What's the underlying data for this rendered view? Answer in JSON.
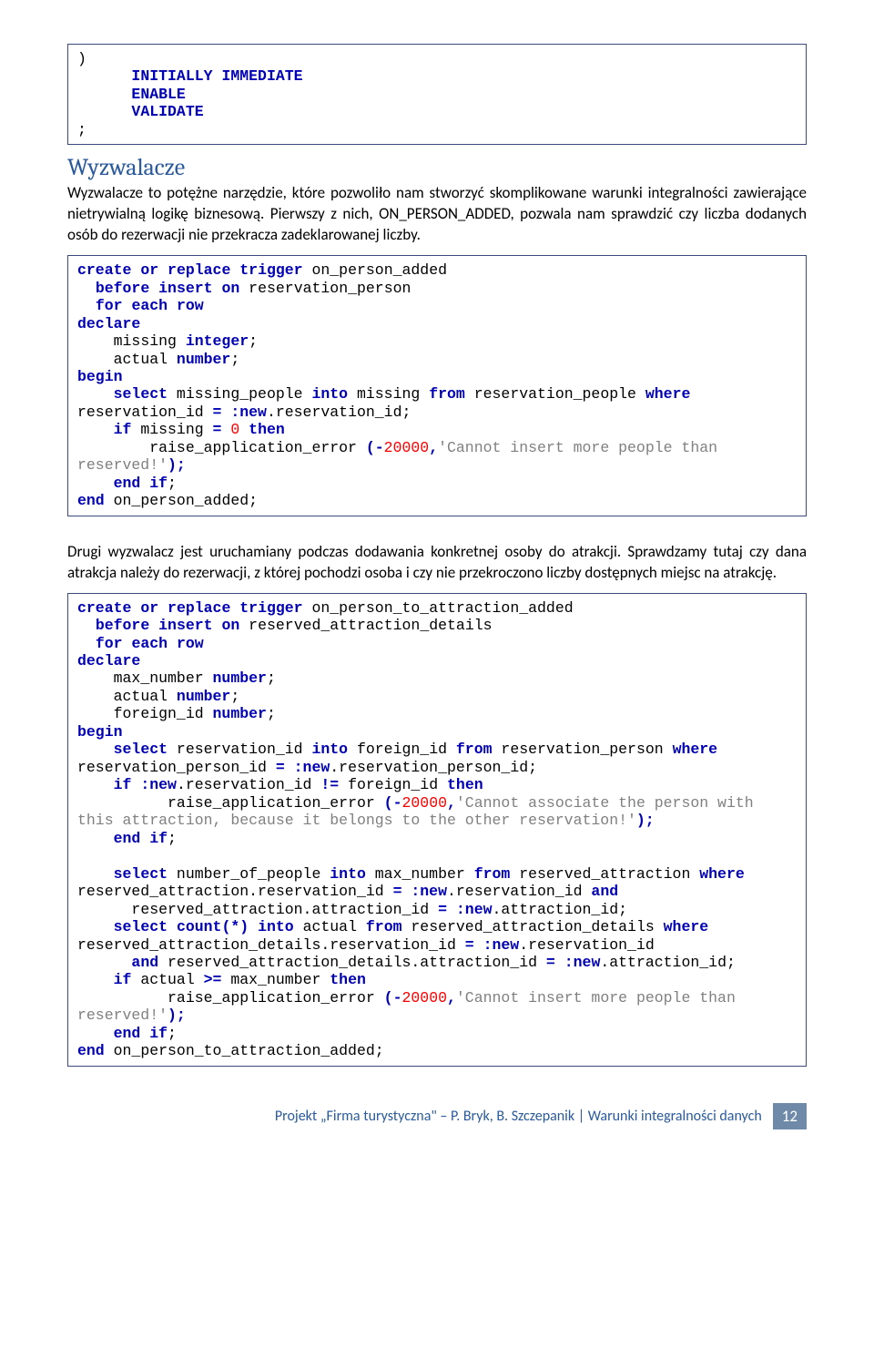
{
  "code_block_1": {
    "lines": [
      [
        {
          "c": "id",
          "t": ")"
        }
      ],
      [
        {
          "c": "id",
          "t": "      "
        },
        {
          "c": "k",
          "t": "INITIALLY"
        },
        {
          "c": "id",
          "t": " "
        },
        {
          "c": "k",
          "t": "IMMEDIATE"
        }
      ],
      [
        {
          "c": "id",
          "t": "      "
        },
        {
          "c": "k",
          "t": "ENABLE"
        }
      ],
      [
        {
          "c": "id",
          "t": "      "
        },
        {
          "c": "k",
          "t": "VALIDATE"
        }
      ],
      [
        {
          "c": "id",
          "t": ";"
        }
      ]
    ]
  },
  "heading_1": "Wyzwalacze",
  "para_1": "Wyzwalacze to potężne narzędzie, które pozwoliło nam stworzyć skomplikowane warunki integralności zawierające nietrywialną logikę biznesową. Pierwszy z nich, ON_PERSON_ADDED, pozwala nam sprawdzić czy liczba dodanych osób do rezerwacji nie przekracza zadeklarowanej liczby.",
  "code_block_2": {
    "lines": [
      [
        {
          "c": "k",
          "t": "create"
        },
        {
          "c": "id",
          "t": " "
        },
        {
          "c": "k",
          "t": "or"
        },
        {
          "c": "id",
          "t": " "
        },
        {
          "c": "k",
          "t": "replace"
        },
        {
          "c": "id",
          "t": " "
        },
        {
          "c": "k",
          "t": "trigger"
        },
        {
          "c": "id",
          "t": " on_person_added"
        }
      ],
      [
        {
          "c": "id",
          "t": "  "
        },
        {
          "c": "k",
          "t": "before"
        },
        {
          "c": "id",
          "t": " "
        },
        {
          "c": "k",
          "t": "insert"
        },
        {
          "c": "id",
          "t": " "
        },
        {
          "c": "k",
          "t": "on"
        },
        {
          "c": "id",
          "t": " reservation_person"
        }
      ],
      [
        {
          "c": "id",
          "t": "  "
        },
        {
          "c": "k",
          "t": "for"
        },
        {
          "c": "id",
          "t": " "
        },
        {
          "c": "k",
          "t": "each"
        },
        {
          "c": "id",
          "t": " "
        },
        {
          "c": "k",
          "t": "row"
        }
      ],
      [
        {
          "c": "k",
          "t": "declare"
        }
      ],
      [
        {
          "c": "id",
          "t": "    missing "
        },
        {
          "c": "t",
          "t": "integer"
        },
        {
          "c": "id",
          "t": ";"
        }
      ],
      [
        {
          "c": "id",
          "t": "    actual "
        },
        {
          "c": "t",
          "t": "number"
        },
        {
          "c": "id",
          "t": ";"
        }
      ],
      [
        {
          "c": "k",
          "t": "begin"
        }
      ],
      [
        {
          "c": "id",
          "t": "    "
        },
        {
          "c": "k",
          "t": "select"
        },
        {
          "c": "id",
          "t": " missing_people "
        },
        {
          "c": "k",
          "t": "into"
        },
        {
          "c": "id",
          "t": " missing "
        },
        {
          "c": "k",
          "t": "from"
        },
        {
          "c": "id",
          "t": " reservation_people "
        },
        {
          "c": "k",
          "t": "where"
        },
        {
          "c": "id",
          "t": " reservation_id "
        },
        {
          "c": "k",
          "t": "="
        },
        {
          "c": "id",
          "t": " "
        },
        {
          "c": "kbv",
          "t": ":new"
        },
        {
          "c": "id",
          "t": ".reservation_id;"
        }
      ],
      [
        {
          "c": "id",
          "t": "    "
        },
        {
          "c": "k",
          "t": "if"
        },
        {
          "c": "id",
          "t": " missing "
        },
        {
          "c": "k",
          "t": "="
        },
        {
          "c": "id",
          "t": " "
        },
        {
          "c": "n",
          "t": "0"
        },
        {
          "c": "id",
          "t": " "
        },
        {
          "c": "k",
          "t": "then"
        }
      ],
      [
        {
          "c": "id",
          "t": "        raise_application_error "
        },
        {
          "c": "k",
          "t": "(-"
        },
        {
          "c": "n",
          "t": "20000"
        },
        {
          "c": "k",
          "t": ","
        },
        {
          "c": "s",
          "t": "'Cannot insert more people than reserved!'"
        },
        {
          "c": "k",
          "t": ");"
        }
      ],
      [
        {
          "c": "id",
          "t": "    "
        },
        {
          "c": "k",
          "t": "end"
        },
        {
          "c": "id",
          "t": " "
        },
        {
          "c": "k",
          "t": "if"
        },
        {
          "c": "id",
          "t": ";"
        }
      ],
      [
        {
          "c": "k",
          "t": "end"
        },
        {
          "c": "id",
          "t": " on_person_added;"
        }
      ]
    ]
  },
  "para_2": "Drugi wyzwalacz jest uruchamiany podczas dodawania konkretnej osoby do atrakcji. Sprawdzamy tutaj czy dana atrakcja należy do rezerwacji, z której pochodzi osoba i czy nie przekroczono liczby dostępnych miejsc na atrakcję.",
  "code_block_3": {
    "lines": [
      [
        {
          "c": "k",
          "t": "create"
        },
        {
          "c": "id",
          "t": " "
        },
        {
          "c": "k",
          "t": "or"
        },
        {
          "c": "id",
          "t": " "
        },
        {
          "c": "k",
          "t": "replace"
        },
        {
          "c": "id",
          "t": " "
        },
        {
          "c": "k",
          "t": "trigger"
        },
        {
          "c": "id",
          "t": " on_person_to_attraction_added"
        }
      ],
      [
        {
          "c": "id",
          "t": "  "
        },
        {
          "c": "k",
          "t": "before"
        },
        {
          "c": "id",
          "t": " "
        },
        {
          "c": "k",
          "t": "insert"
        },
        {
          "c": "id",
          "t": " "
        },
        {
          "c": "k",
          "t": "on"
        },
        {
          "c": "id",
          "t": " reserved_attraction_details"
        }
      ],
      [
        {
          "c": "id",
          "t": "  "
        },
        {
          "c": "k",
          "t": "for"
        },
        {
          "c": "id",
          "t": " "
        },
        {
          "c": "k",
          "t": "each"
        },
        {
          "c": "id",
          "t": " "
        },
        {
          "c": "k",
          "t": "row"
        }
      ],
      [
        {
          "c": "k",
          "t": "declare"
        }
      ],
      [
        {
          "c": "id",
          "t": "    max_number "
        },
        {
          "c": "t",
          "t": "number"
        },
        {
          "c": "id",
          "t": ";"
        }
      ],
      [
        {
          "c": "id",
          "t": "    actual "
        },
        {
          "c": "t",
          "t": "number"
        },
        {
          "c": "id",
          "t": ";"
        }
      ],
      [
        {
          "c": "id",
          "t": "    foreign_id "
        },
        {
          "c": "t",
          "t": "number"
        },
        {
          "c": "id",
          "t": ";"
        }
      ],
      [
        {
          "c": "k",
          "t": "begin"
        }
      ],
      [
        {
          "c": "id",
          "t": "    "
        },
        {
          "c": "k",
          "t": "select"
        },
        {
          "c": "id",
          "t": " reservation_id "
        },
        {
          "c": "k",
          "t": "into"
        },
        {
          "c": "id",
          "t": " foreign_id "
        },
        {
          "c": "k",
          "t": "from"
        },
        {
          "c": "id",
          "t": " reservation_person "
        },
        {
          "c": "k",
          "t": "where"
        },
        {
          "c": "id",
          "t": " reservation_person_id "
        },
        {
          "c": "k",
          "t": "="
        },
        {
          "c": "id",
          "t": " "
        },
        {
          "c": "kbv",
          "t": ":new"
        },
        {
          "c": "id",
          "t": ".reservation_person_id;"
        }
      ],
      [
        {
          "c": "id",
          "t": "    "
        },
        {
          "c": "k",
          "t": "if"
        },
        {
          "c": "id",
          "t": " "
        },
        {
          "c": "kbv",
          "t": ":new"
        },
        {
          "c": "id",
          "t": ".reservation_id "
        },
        {
          "c": "k",
          "t": "!="
        },
        {
          "c": "id",
          "t": " foreign_id "
        },
        {
          "c": "k",
          "t": "then"
        }
      ],
      [
        {
          "c": "id",
          "t": "          raise_application_error "
        },
        {
          "c": "k",
          "t": "(-"
        },
        {
          "c": "n",
          "t": "20000"
        },
        {
          "c": "k",
          "t": ","
        },
        {
          "c": "s",
          "t": "'Cannot associate the person with this attraction, because it belongs to the other reservation!'"
        },
        {
          "c": "k",
          "t": ");"
        }
      ],
      [
        {
          "c": "id",
          "t": "    "
        },
        {
          "c": "k",
          "t": "end"
        },
        {
          "c": "id",
          "t": " "
        },
        {
          "c": "k",
          "t": "if"
        },
        {
          "c": "id",
          "t": ";"
        }
      ],
      [
        {
          "c": "id",
          "t": ""
        }
      ],
      [
        {
          "c": "id",
          "t": "    "
        },
        {
          "c": "k",
          "t": "select"
        },
        {
          "c": "id",
          "t": " number_of_people "
        },
        {
          "c": "k",
          "t": "into"
        },
        {
          "c": "id",
          "t": " max_number "
        },
        {
          "c": "k",
          "t": "from"
        },
        {
          "c": "id",
          "t": " reserved_attraction "
        },
        {
          "c": "k",
          "t": "where"
        },
        {
          "c": "id",
          "t": " reserved_attraction.reservation_id "
        },
        {
          "c": "k",
          "t": "="
        },
        {
          "c": "id",
          "t": " "
        },
        {
          "c": "kbv",
          "t": ":new"
        },
        {
          "c": "id",
          "t": ".reservation_id "
        },
        {
          "c": "k",
          "t": "and"
        }
      ],
      [
        {
          "c": "id",
          "t": "      reserved_attraction.attraction_id "
        },
        {
          "c": "k",
          "t": "="
        },
        {
          "c": "id",
          "t": " "
        },
        {
          "c": "kbv",
          "t": ":new"
        },
        {
          "c": "id",
          "t": ".attraction_id;"
        }
      ],
      [
        {
          "c": "id",
          "t": "    "
        },
        {
          "c": "k",
          "t": "select"
        },
        {
          "c": "id",
          "t": " "
        },
        {
          "c": "k",
          "t": "count(*)"
        },
        {
          "c": "id",
          "t": " "
        },
        {
          "c": "k",
          "t": "into"
        },
        {
          "c": "id",
          "t": " actual "
        },
        {
          "c": "k",
          "t": "from"
        },
        {
          "c": "id",
          "t": " reserved_attraction_details "
        },
        {
          "c": "k",
          "t": "where"
        },
        {
          "c": "id",
          "t": " reserved_attraction_details.reservation_id "
        },
        {
          "c": "k",
          "t": "="
        },
        {
          "c": "id",
          "t": " "
        },
        {
          "c": "kbv",
          "t": ":new"
        },
        {
          "c": "id",
          "t": ".reservation_id"
        }
      ],
      [
        {
          "c": "id",
          "t": "      "
        },
        {
          "c": "k",
          "t": "and"
        },
        {
          "c": "id",
          "t": " reserved_attraction_details.attraction_id "
        },
        {
          "c": "k",
          "t": "="
        },
        {
          "c": "id",
          "t": " "
        },
        {
          "c": "kbv",
          "t": ":new"
        },
        {
          "c": "id",
          "t": ".attraction_id;"
        }
      ],
      [
        {
          "c": "id",
          "t": "    "
        },
        {
          "c": "k",
          "t": "if"
        },
        {
          "c": "id",
          "t": " actual "
        },
        {
          "c": "k",
          "t": ">="
        },
        {
          "c": "id",
          "t": " max_number "
        },
        {
          "c": "k",
          "t": "then"
        }
      ],
      [
        {
          "c": "id",
          "t": "          raise_application_error "
        },
        {
          "c": "k",
          "t": "(-"
        },
        {
          "c": "n",
          "t": "20000"
        },
        {
          "c": "k",
          "t": ","
        },
        {
          "c": "s",
          "t": "'Cannot insert more people than reserved!'"
        },
        {
          "c": "k",
          "t": ");"
        }
      ],
      [
        {
          "c": "id",
          "t": "    "
        },
        {
          "c": "k",
          "t": "end"
        },
        {
          "c": "id",
          "t": " "
        },
        {
          "c": "k",
          "t": "if"
        },
        {
          "c": "id",
          "t": ";"
        }
      ],
      [
        {
          "c": "k",
          "t": "end"
        },
        {
          "c": "id",
          "t": " on_person_to_attraction_added;"
        }
      ]
    ]
  },
  "footer": {
    "text": "Projekt „Firma turystyczna\" – P. Bryk, B. Szczepanik | Warunki integralności danych",
    "page": "12"
  }
}
